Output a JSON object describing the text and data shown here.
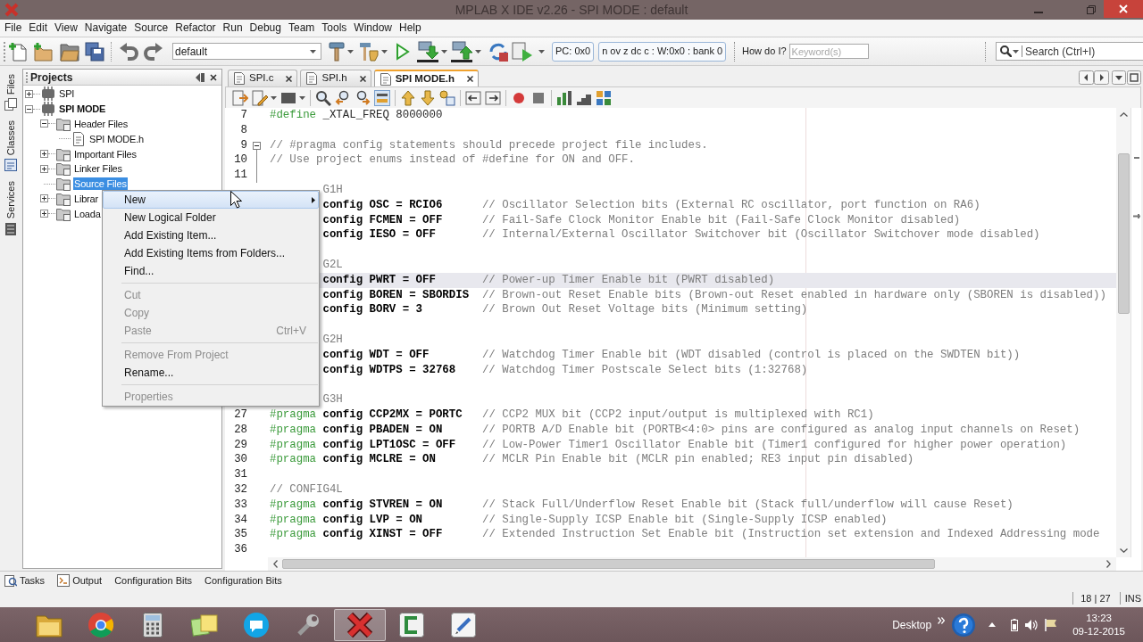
{
  "window": {
    "title": "MPLAB X IDE v2.26 - SPI MODE : default"
  },
  "menu_bar": [
    "File",
    "Edit",
    "View",
    "Navigate",
    "Source",
    "Refactor",
    "Run",
    "Debug",
    "Team",
    "Tools",
    "Window",
    "Help"
  ],
  "toolbar": {
    "configuration": "default",
    "pc": "PC: 0x0",
    "registers": "n ov z dc c : W:0x0 : bank 0",
    "help_label": "How do I?",
    "help_placeholder": "Keyword(s)",
    "search_placeholder": "Search (Ctrl+I)"
  },
  "side_tabs": [
    "Files",
    "Classes",
    "Services"
  ],
  "projects": {
    "title": "Projects",
    "tree": [
      {
        "label": "SPI",
        "kind": "project",
        "main": false,
        "expanded": false,
        "selected": false
      },
      {
        "label": "SPI MODE",
        "kind": "project",
        "main": true,
        "expanded": true,
        "selected": false,
        "children": [
          {
            "label": "Header Files",
            "kind": "folder",
            "expanded": true,
            "selected": false,
            "children": [
              {
                "label": "SPI MODE.h",
                "kind": "file",
                "selected": false
              }
            ]
          },
          {
            "label": "Important Files",
            "kind": "folder",
            "expanded": false,
            "selected": false
          },
          {
            "label": "Linker Files",
            "kind": "folder",
            "expanded": false,
            "selected": false
          },
          {
            "label": "Source Files",
            "kind": "folder",
            "selected": true
          },
          {
            "label": "Librar",
            "kind": "folder",
            "expanded": false,
            "selected": false
          },
          {
            "label": "Loada",
            "kind": "folder",
            "expanded": false,
            "selected": false
          }
        ]
      }
    ]
  },
  "editor": {
    "tabs": [
      {
        "label": "SPI.c",
        "selected": false
      },
      {
        "label": "SPI.h",
        "selected": false
      },
      {
        "label": "SPI MODE.h",
        "selected": true
      }
    ],
    "lines": [
      {
        "kind": "define",
        "number": "7",
        "directive": "#define",
        "code": "_XTAL_FREQ 8000000",
        "current": false
      },
      {
        "kind": "blank",
        "number": "8",
        "current": false
      },
      {
        "kind": "fold_start",
        "number": "9",
        "comment": "// #pragma config statements should precede project file includes.",
        "current": false
      },
      {
        "kind": "fold_comment",
        "number": "10",
        "comment": "// Use project enums instead of #define for ON and OFF.",
        "current": false
      },
      {
        "kind": "fold_blank",
        "number": "11",
        "current": false
      },
      {
        "kind": "covered",
        "comment": "G1H",
        "current": false
      },
      {
        "kind": "covered",
        "code": "config OSC = RCIO6",
        "comment": "// Oscillator Selection bits (External RC oscillator, port function on RA6)",
        "current": false
      },
      {
        "kind": "covered",
        "code": "config FCMEN = OFF",
        "comment": "// Fail-Safe Clock Monitor Enable bit (Fail-Safe Clock Monitor disabled)",
        "current": false
      },
      {
        "kind": "covered",
        "code": "config IESO = OFF",
        "comment": "// Internal/External Oscillator Switchover bit (Oscillator Switchover mode disabled)",
        "current": false
      },
      {
        "kind": "covered",
        "current": false
      },
      {
        "kind": "covered",
        "comment": "G2L",
        "current": false
      },
      {
        "kind": "covered",
        "code": "config PWRT = OFF",
        "comment": "// Power-up Timer Enable bit (PWRT disabled)",
        "current": true
      },
      {
        "kind": "covered",
        "code": "config BOREN = SBORDIS",
        "comment": "// Brown-out Reset Enable bits (Brown-out Reset enabled in hardware only (SBOREN is disabled))",
        "current": false
      },
      {
        "kind": "covered",
        "code": "config BORV = 3",
        "comment": "// Brown Out Reset Voltage bits (Minimum setting)",
        "current": false
      },
      {
        "kind": "covered",
        "current": false
      },
      {
        "kind": "covered",
        "comment": "G2H",
        "current": false
      },
      {
        "kind": "covered",
        "code": "config WDT = OFF",
        "comment": "// Watchdog Timer Enable bit (WDT disabled (control is placed on the SWDTEN bit))",
        "current": false
      },
      {
        "kind": "covered",
        "code": "config WDTPS = 32768",
        "comment": "// Watchdog Timer Postscale Select bits (1:32768)",
        "current": false
      },
      {
        "kind": "covered",
        "current": false
      },
      {
        "kind": "covered",
        "comment": "G3H",
        "current": false
      },
      {
        "kind": "pragma",
        "number": "27",
        "directive": "#pragma",
        "code": "config CCP2MX = PORTC",
        "comment": "// CCP2 MUX bit (CCP2 input/output is multiplexed with RC1)",
        "current": false
      },
      {
        "kind": "pragma",
        "number": "28",
        "directive": "#pragma",
        "code": "config PBADEN = ON",
        "comment": "// PORTB A/D Enable bit (PORTB<4:0> pins are configured as analog input channels on Reset)",
        "current": false
      },
      {
        "kind": "pragma",
        "number": "29",
        "directive": "#pragma",
        "code": "config LPT1OSC = OFF",
        "comment": "// Low-Power Timer1 Oscillator Enable bit (Timer1 configured for higher power operation)",
        "current": false
      },
      {
        "kind": "pragma",
        "number": "30",
        "directive": "#pragma",
        "code": "config MCLRE = ON",
        "comment": "// MCLR Pin Enable bit (MCLR pin enabled; RE3 input pin disabled)",
        "current": false
      },
      {
        "kind": "blank",
        "number": "31",
        "current": false
      },
      {
        "kind": "comment",
        "number": "32",
        "comment": "// CONFIG4L",
        "current": false
      },
      {
        "kind": "pragma",
        "number": "33",
        "directive": "#pragma",
        "code": "config STVREN = ON",
        "comment": "// Stack Full/Underflow Reset Enable bit (Stack full/underflow will cause Reset)",
        "current": false
      },
      {
        "kind": "pragma",
        "number": "34",
        "directive": "#pragma",
        "code": "config LVP = ON",
        "comment": "// Single-Supply ICSP Enable bit (Single-Supply ICSP enabled)",
        "current": false
      },
      {
        "kind": "pragma",
        "number": "35",
        "directive": "#pragma",
        "code": "config XINST = OFF",
        "comment": "// Extended Instruction Set Enable bit (Instruction set extension and Indexed Addressing mode",
        "current": false
      },
      {
        "kind": "blank",
        "number": "36",
        "current": false
      }
    ]
  },
  "context_menu": {
    "items": [
      {
        "kind": "submenu",
        "label": "New",
        "selected": true,
        "disabled": false
      },
      {
        "kind": "item",
        "label": "New Logical Folder",
        "selected": false,
        "disabled": false
      },
      {
        "kind": "item",
        "label": "Add Existing Item...",
        "selected": false,
        "disabled": false
      },
      {
        "kind": "item",
        "label": "Add Existing Items from Folders...",
        "selected": false,
        "disabled": false
      },
      {
        "kind": "item",
        "label": "Find...",
        "selected": false,
        "disabled": false
      },
      {
        "kind": "separator"
      },
      {
        "kind": "item",
        "label": "Cut",
        "selected": false,
        "disabled": true
      },
      {
        "kind": "item",
        "label": "Copy",
        "selected": false,
        "disabled": true
      },
      {
        "kind": "item",
        "label": "Paste",
        "shortcut": "Ctrl+V",
        "selected": false,
        "disabled": true
      },
      {
        "kind": "separator"
      },
      {
        "kind": "item",
        "label": "Remove From Project",
        "selected": false,
        "disabled": true
      },
      {
        "kind": "item",
        "label": "Rename...",
        "selected": false,
        "disabled": false
      },
      {
        "kind": "separator"
      },
      {
        "kind": "item",
        "label": "Properties",
        "selected": false,
        "disabled": true
      }
    ]
  },
  "bottom_tabs": [
    {
      "kind": "tasks",
      "label": "Tasks"
    },
    {
      "kind": "output",
      "label": "Output"
    },
    {
      "kind": "plain",
      "label": "Configuration Bits"
    },
    {
      "kind": "plain",
      "label": "Configuration Bits"
    }
  ],
  "status_bar": {
    "position": "18 | 27",
    "mode": "INS"
  },
  "taskbar": {
    "apps": [
      {
        "kind": "folder",
        "active": false
      },
      {
        "kind": "browser",
        "active": false
      },
      {
        "kind": "calculator",
        "active": false
      },
      {
        "kind": "notes",
        "active": false
      },
      {
        "kind": "chat",
        "active": false
      },
      {
        "kind": "tool",
        "active": false
      },
      {
        "kind": "mplab",
        "active": true
      },
      {
        "kind": "recorder",
        "active": false
      },
      {
        "kind": "pen",
        "active": false
      }
    ],
    "tray_label": "Desktop",
    "time": "13:23",
    "date": "09-12-2015"
  }
}
